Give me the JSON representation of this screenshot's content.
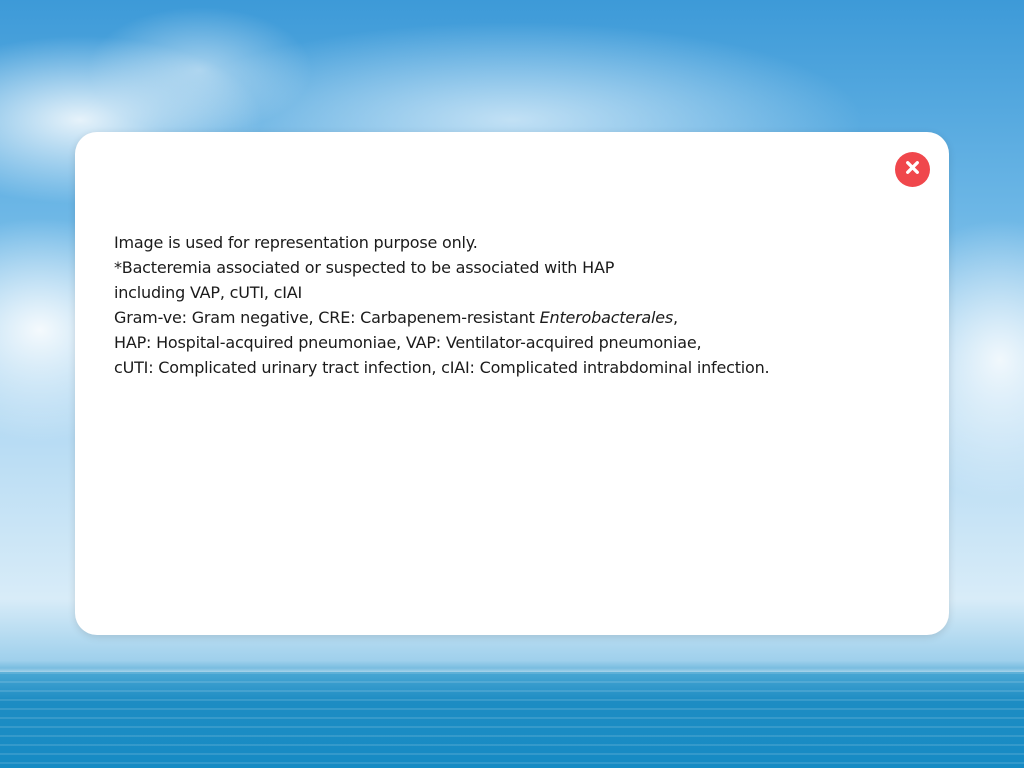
{
  "modal": {
    "close_icon": "close-icon",
    "accent_color": "#f0474c",
    "lines": [
      "Image is used for representation purpose only.",
      "*Bacteremia associated or suspected to be associated with HAP",
      "including VAP, cUTI, cIAI",
      {
        "before": "Gram-ve: Gram negative, CRE: Carbapenem-resistant ",
        "italic": "Enterobacterales",
        "after": ","
      },
      "HAP: Hospital-acquired pneumoniae, VAP: Ventilator-acquired pneumoniae,",
      "cUTI: Complicated urinary tract infection, cIAI: Complicated intrabdominal infection."
    ]
  }
}
